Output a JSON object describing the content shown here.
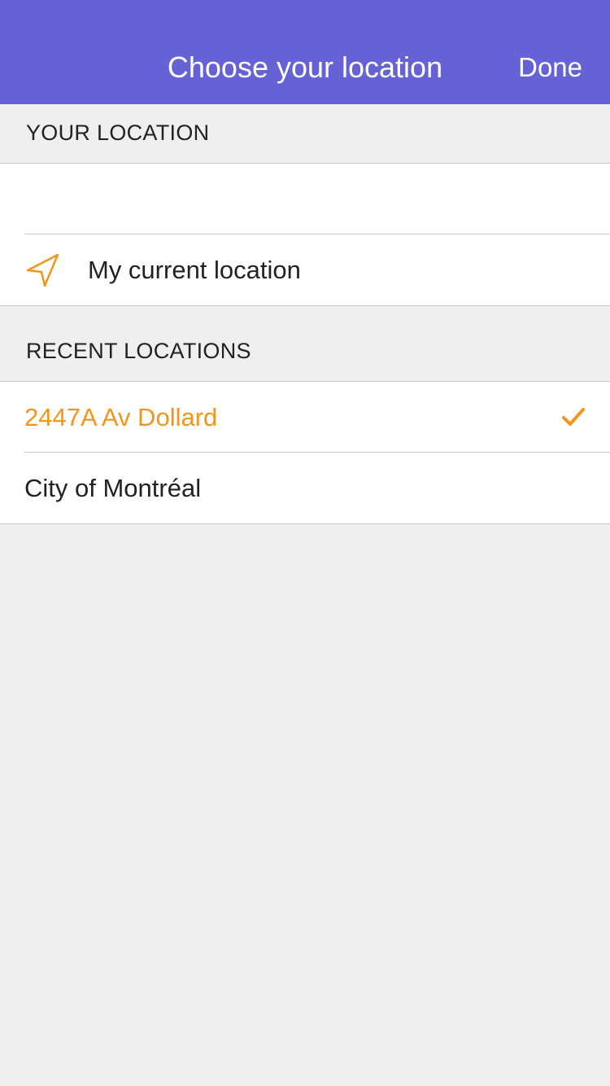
{
  "header": {
    "title": "Choose your location",
    "done_label": "Done",
    "background_color": "#6661d4"
  },
  "your_location": {
    "section_title": "YOUR LOCATION",
    "search": {
      "value": "",
      "placeholder": ""
    },
    "current_location": {
      "label": "My current location",
      "icon": "location-arrow-icon"
    }
  },
  "recent_locations": {
    "section_title": "RECENT LOCATIONS",
    "items": [
      {
        "label": "2447A Av Dollard",
        "selected": true
      },
      {
        "label": "City of Montréal",
        "selected": false
      }
    ],
    "selected_color": "#f2951c",
    "check_icon": "checkmark-icon"
  }
}
